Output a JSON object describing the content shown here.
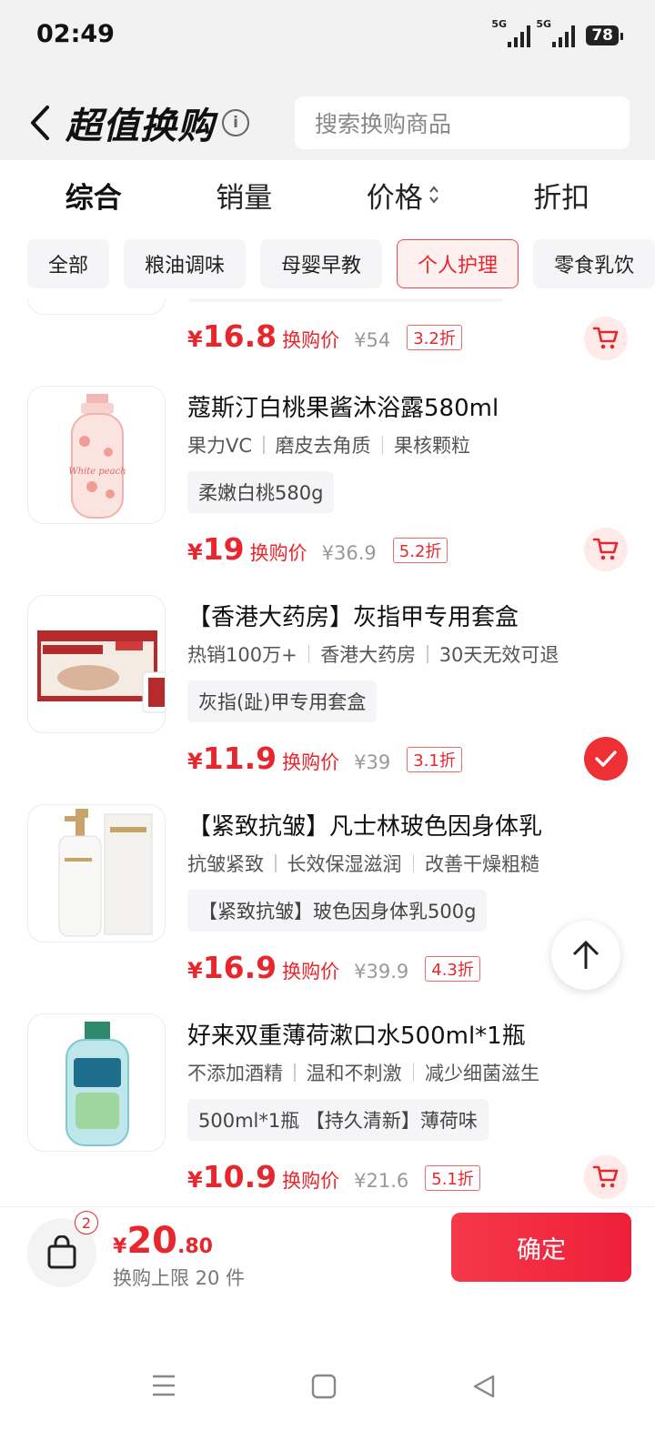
{
  "status": {
    "time": "02:49",
    "signal1": "5G",
    "signal2": "5G",
    "battery": "78"
  },
  "header": {
    "title": "超值换购",
    "search_placeholder": "搜索换购商品"
  },
  "sort": {
    "items": [
      "综合",
      "销量",
      "价格",
      "折扣"
    ]
  },
  "categories": [
    "全部",
    "粮油调味",
    "母婴早教",
    "个人护理",
    "零食乳饮"
  ],
  "partial_item": {
    "price": "16.8",
    "price_label": "换购价",
    "orig": "¥54",
    "discount": "3.2折"
  },
  "products": [
    {
      "name": "蔻斯汀白桃果酱沐浴露580ml",
      "features": [
        "果力VC",
        "磨皮去角质",
        "果核颗粒"
      ],
      "spec": "柔嫩白桃580g",
      "price": "19",
      "price_label": "换购价",
      "orig": "¥36.9",
      "discount": "5.2折",
      "selected": false
    },
    {
      "name": "【香港大药房】灰指甲专用套盒",
      "features": [
        "热销100万+",
        "香港大药房",
        "30天无效可退"
      ],
      "spec": "灰指(趾)甲专用套盒",
      "price": "11.9",
      "price_label": "换购价",
      "orig": "¥39",
      "discount": "3.1折",
      "selected": true
    },
    {
      "name": "【紧致抗皱】凡士林玻色因身体乳",
      "features": [
        "抗皱紧致",
        "长效保湿滋润",
        "改善干燥粗糙"
      ],
      "spec": "【紧致抗皱】玻色因身体乳500g",
      "price": "16.9",
      "price_label": "换购价",
      "orig": "¥39.9",
      "discount": "4.3折",
      "selected": false
    },
    {
      "name": "好来双重薄荷漱口水500ml*1瓶",
      "features": [
        "不添加酒精",
        "温和不刺激",
        "减少细菌滋生"
      ],
      "spec": "500ml*1瓶 【持久清新】薄荷味",
      "price": "10.9",
      "price_label": "换购价",
      "orig": "¥21.6",
      "discount": "5.1折",
      "selected": false
    }
  ],
  "footer": {
    "badge": "2",
    "yen": "¥",
    "total_int": "20",
    "total_dec": ".80",
    "limit": "换购上限 20 件",
    "confirm": "确定"
  },
  "colors": {
    "accent": "#e8262d",
    "chip_active_bg": "#fff0f0",
    "confirm": "#f0253c"
  },
  "icons": [
    "back-chevron-icon",
    "info-icon",
    "sort-caret-icon",
    "cart-icon",
    "check-icon",
    "arrow-up-icon",
    "bag-icon",
    "menu-icon",
    "home-square-icon",
    "back-triangle-icon"
  ]
}
